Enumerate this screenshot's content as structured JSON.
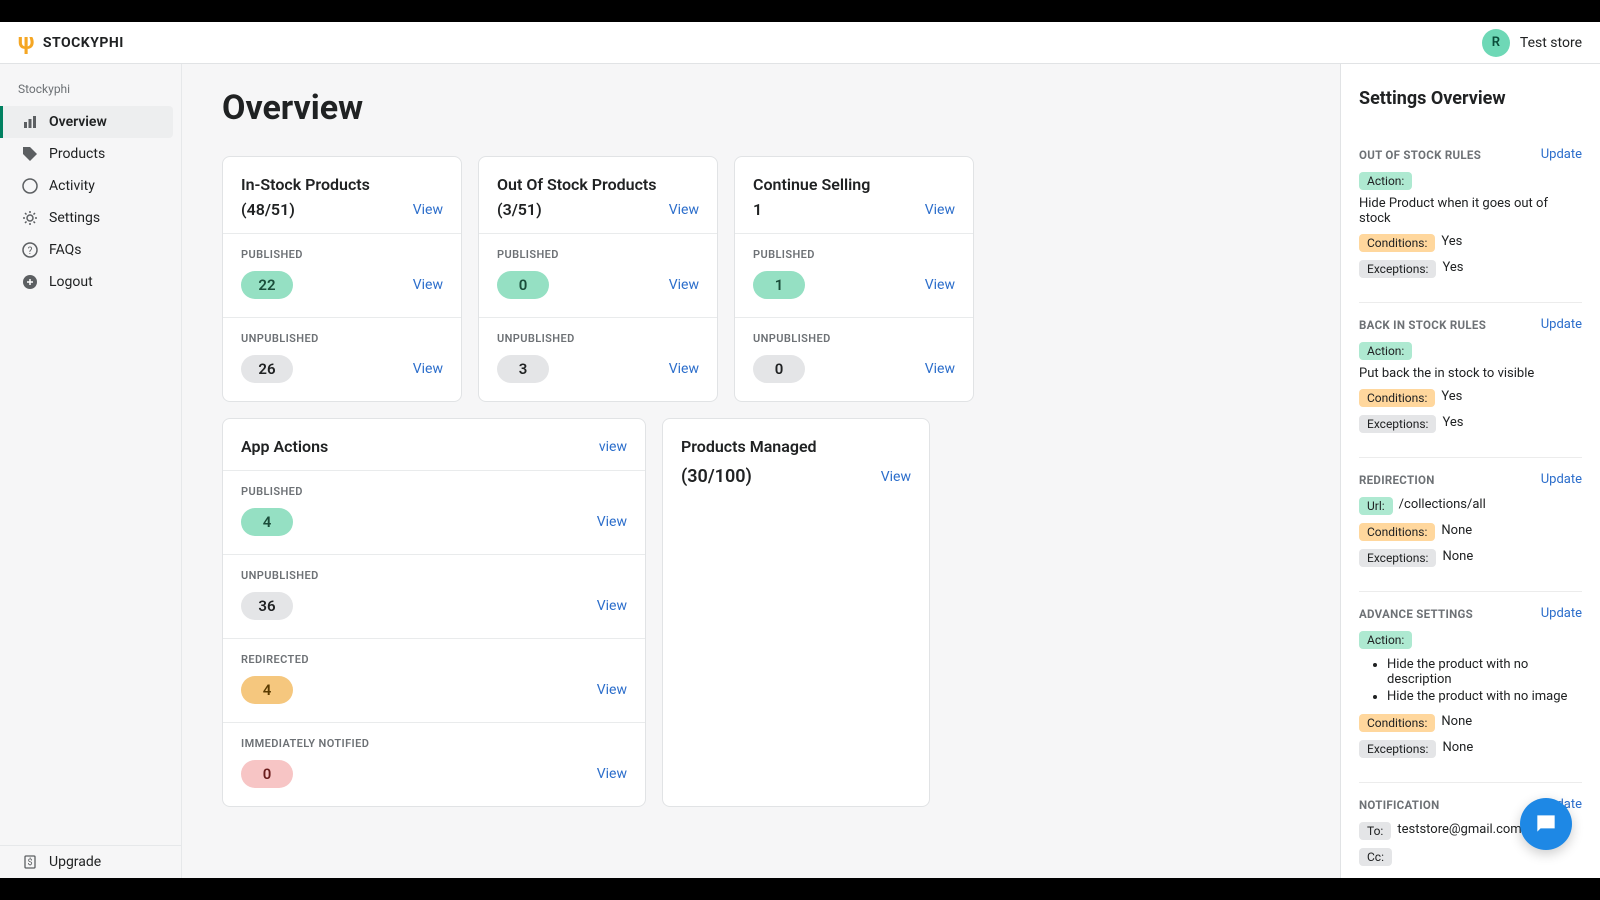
{
  "brand": {
    "name": "STOCKYPHI"
  },
  "user": {
    "initial": "R",
    "store": "Test store"
  },
  "sidebar": {
    "heading": "Stockyphi",
    "items": [
      {
        "label": "Overview"
      },
      {
        "label": "Products"
      },
      {
        "label": "Activity"
      },
      {
        "label": "Settings"
      },
      {
        "label": "FAQs"
      },
      {
        "label": "Logout"
      }
    ],
    "upgrade": "Upgrade"
  },
  "page": {
    "title": "Overview"
  },
  "links": {
    "view": "View",
    "view_lc": "view",
    "update": "Update"
  },
  "labels": {
    "published": "PUBLISHED",
    "unpublished": "UNPUBLISHED",
    "redirected": "REDIRECTED",
    "immediately_notified": "IMMEDIATELY NOTIFIED"
  },
  "stats": {
    "in_stock": {
      "title": "In-Stock Products",
      "sub": "(48/51)",
      "published": "22",
      "unpublished": "26"
    },
    "out_stock": {
      "title": "Out Of Stock Products",
      "sub": "(3/51)",
      "published": "0",
      "unpublished": "3"
    },
    "continue": {
      "title": "Continue Selling",
      "sub": "1",
      "published": "1",
      "unpublished": "0"
    }
  },
  "app_actions": {
    "title": "App Actions",
    "published": "4",
    "unpublished": "36",
    "redirected": "4",
    "notified": "0"
  },
  "managed": {
    "title": "Products Managed",
    "sub": "(30/100)"
  },
  "settings_panel": {
    "title": "Settings Overview",
    "tags": {
      "action": "Action:",
      "conditions": "Conditions:",
      "exceptions": "Exceptions:",
      "url": "Url:",
      "to": "To:",
      "cc": "Cc:"
    },
    "oos": {
      "heading": "OUT OF STOCK RULES",
      "action": "Hide Product when it goes out of stock",
      "conditions": "Yes",
      "exceptions": "Yes"
    },
    "bis": {
      "heading": "BACK IN STOCK RULES",
      "action": "Put back the in stock to visible",
      "conditions": "Yes",
      "exceptions": "Yes"
    },
    "redir": {
      "heading": "REDIRECTION",
      "url": "/collections/all",
      "conditions": "None",
      "exceptions": "None"
    },
    "adv": {
      "heading": "ADVANCE SETTINGS",
      "actions_list": [
        "Hide the product with no description",
        "Hide the product with no image"
      ],
      "conditions": "None",
      "exceptions": "None"
    },
    "notif": {
      "heading": "NOTIFICATION",
      "to": "teststore@gmail.com",
      "cc": ""
    }
  }
}
